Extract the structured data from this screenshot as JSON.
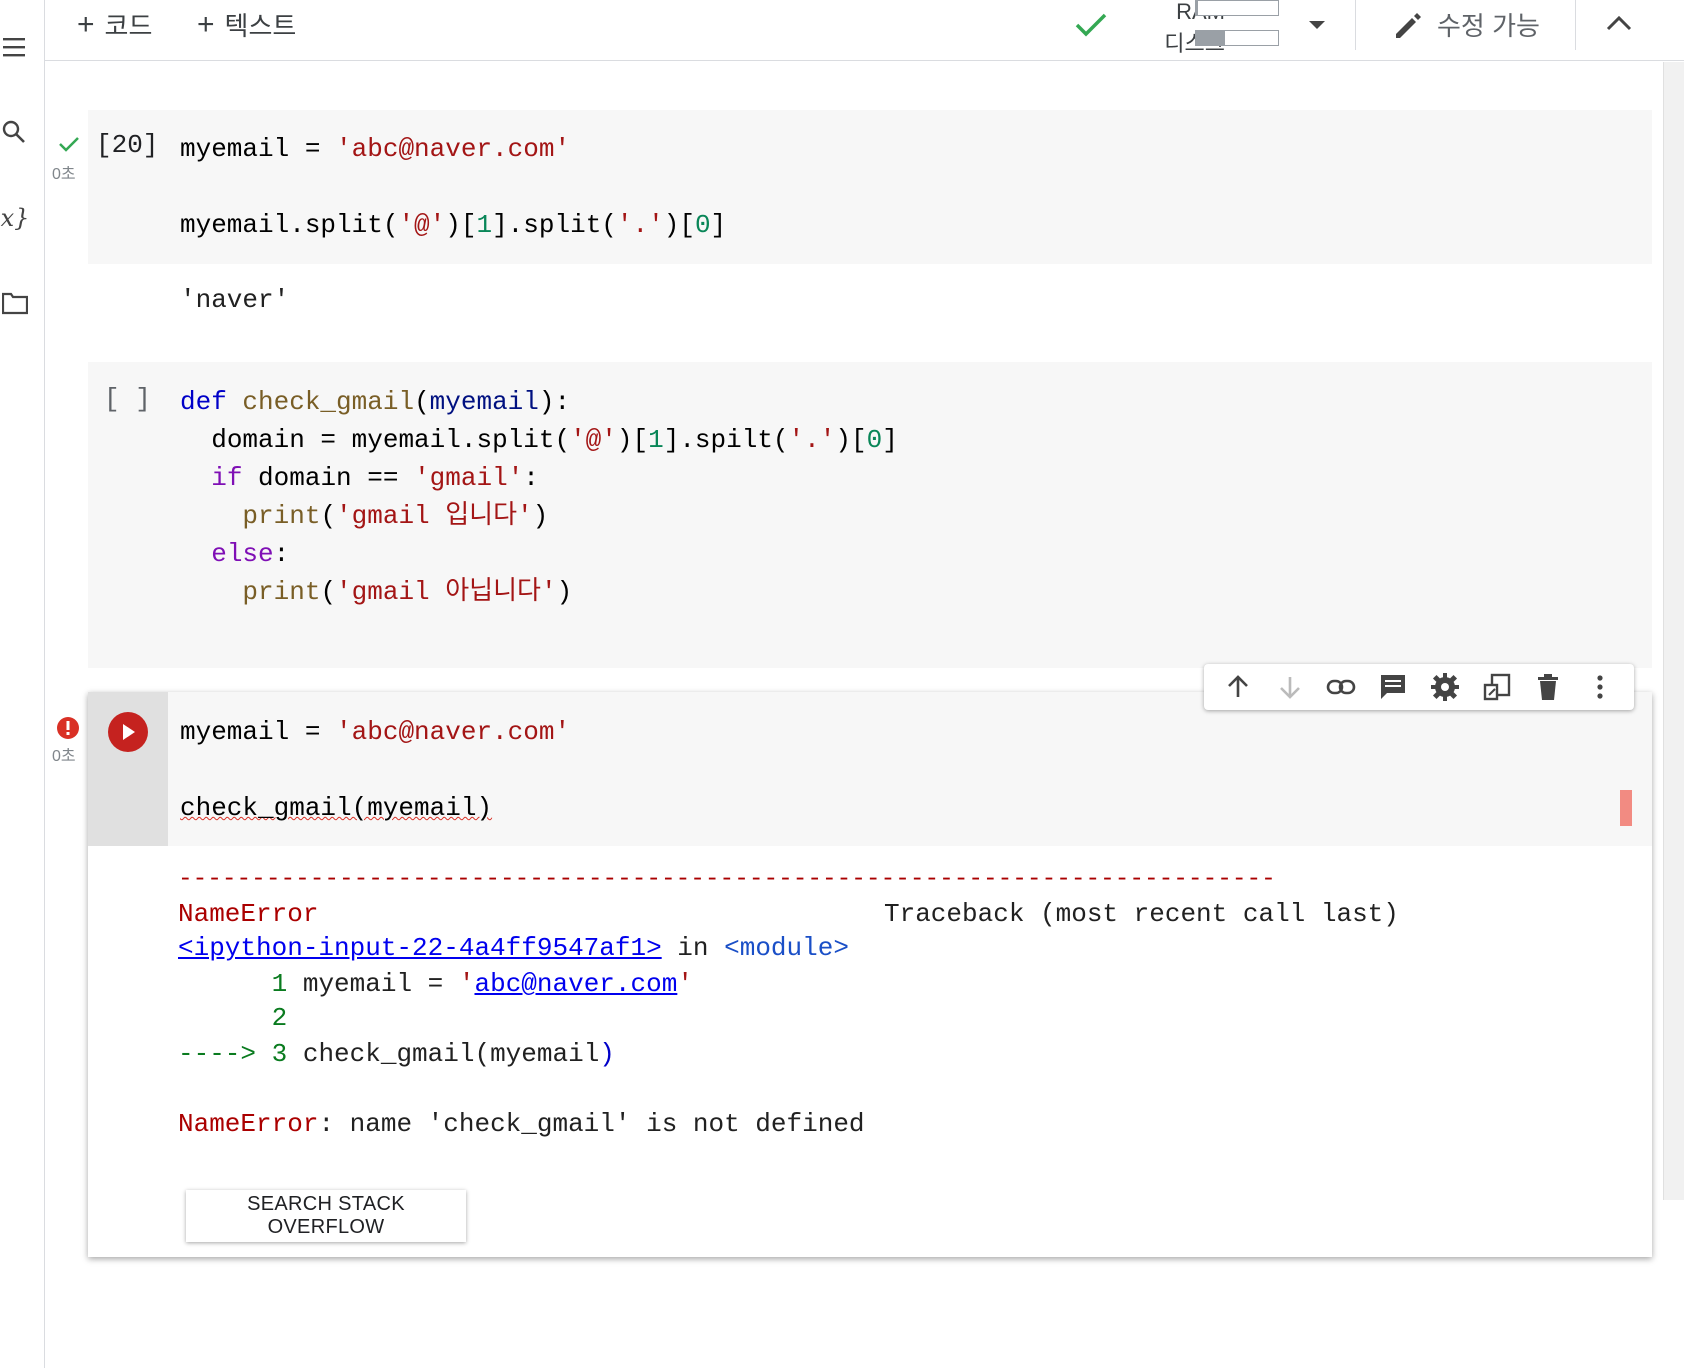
{
  "toolbar": {
    "add_code": "코드",
    "add_text": "텍스트",
    "ram_label": "RAM",
    "disk_label": "디스크",
    "ram_usage": 0.03,
    "disk_usage": 0.35,
    "edit_mode": "수정 가능"
  },
  "cells": {
    "cell1": {
      "exec_count": "[20]",
      "time": "0초",
      "output": "'naver'"
    },
    "cell2": {
      "exec_count": "[ ]"
    },
    "cell3": {
      "time": "0초"
    }
  },
  "traceback": {
    "dashes": "---------------------------------------------------------------------------",
    "error_type": "NameError",
    "header_right": "Traceback (most recent call last)",
    "input_link": "<ipython-input-22-4a4ff9547af1>",
    "in_text": "in",
    "module": "<module>",
    "line1_num": "1",
    "line1_code": "myemail = ",
    "line1_link": "abc@naver.com",
    "line2_num": "2",
    "arrow": "---->",
    "line3_num": "3",
    "line3_code": "check_gmail(myemail",
    "line3_paren": ")",
    "final_error_type": "NameError",
    "final_message": ": name 'check_gmail' is not defined"
  },
  "buttons": {
    "search_so": "SEARCH STACK OVERFLOW"
  },
  "colors": {
    "error_red": "#a00000",
    "run_button": "#c5221f",
    "success_green": "#34a853",
    "error_marker": "#f28b82"
  }
}
